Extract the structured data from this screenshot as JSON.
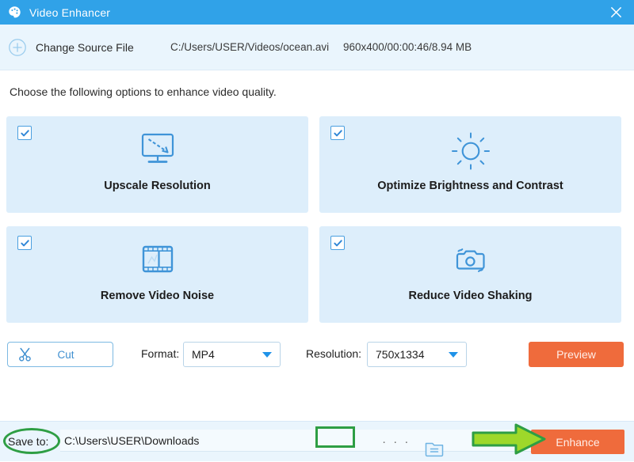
{
  "window": {
    "title": "Video Enhancer",
    "app_icon": "palette-icon",
    "close_icon": "close-icon",
    "titlebar_color": "#30a2e8"
  },
  "source": {
    "change_label": "Change Source File",
    "add_icon": "plus-circle-icon",
    "path": "C:/Users/USER/Videos/ocean.avi",
    "meta": "960x400/00:00:46/8.94 MB"
  },
  "instruction": "Choose the following options to enhance video quality.",
  "options": [
    {
      "label": "Upscale Resolution",
      "icon": "monitor-upscale-icon",
      "checked": true
    },
    {
      "label": "Optimize Brightness and Contrast",
      "icon": "sun-brightness-icon",
      "checked": true
    },
    {
      "label": "Remove Video Noise",
      "icon": "film-strip-icon",
      "checked": true
    },
    {
      "label": "Reduce Video Shaking",
      "icon": "camera-shake-icon",
      "checked": true
    }
  ],
  "controls": {
    "cut_label": "Cut",
    "cut_icon": "scissors-icon",
    "format_label": "Format:",
    "format_value": "MP4",
    "resolution_label": "Resolution:",
    "resolution_value": "750x1334",
    "preview_label": "Preview",
    "caret_icon": "chevron-down-icon"
  },
  "footer": {
    "saveto_label": "Save to:",
    "save_path": "C:\\Users\\USER\\Downloads",
    "browse_label": "· · ·",
    "folder_icon": "open-folder-icon",
    "enhance_label": "Enhance"
  },
  "annotations": {
    "highlight_color": "#2e9e44",
    "arrow_fill": "#9ed82a",
    "ellipse_target": "Save to:",
    "rect_target": "browse-button",
    "arrow_target": "Enhance"
  },
  "colors": {
    "accent_blue": "#30a2e8",
    "card_bg": "#ddeefb",
    "action_orange": "#ef6b3c"
  }
}
